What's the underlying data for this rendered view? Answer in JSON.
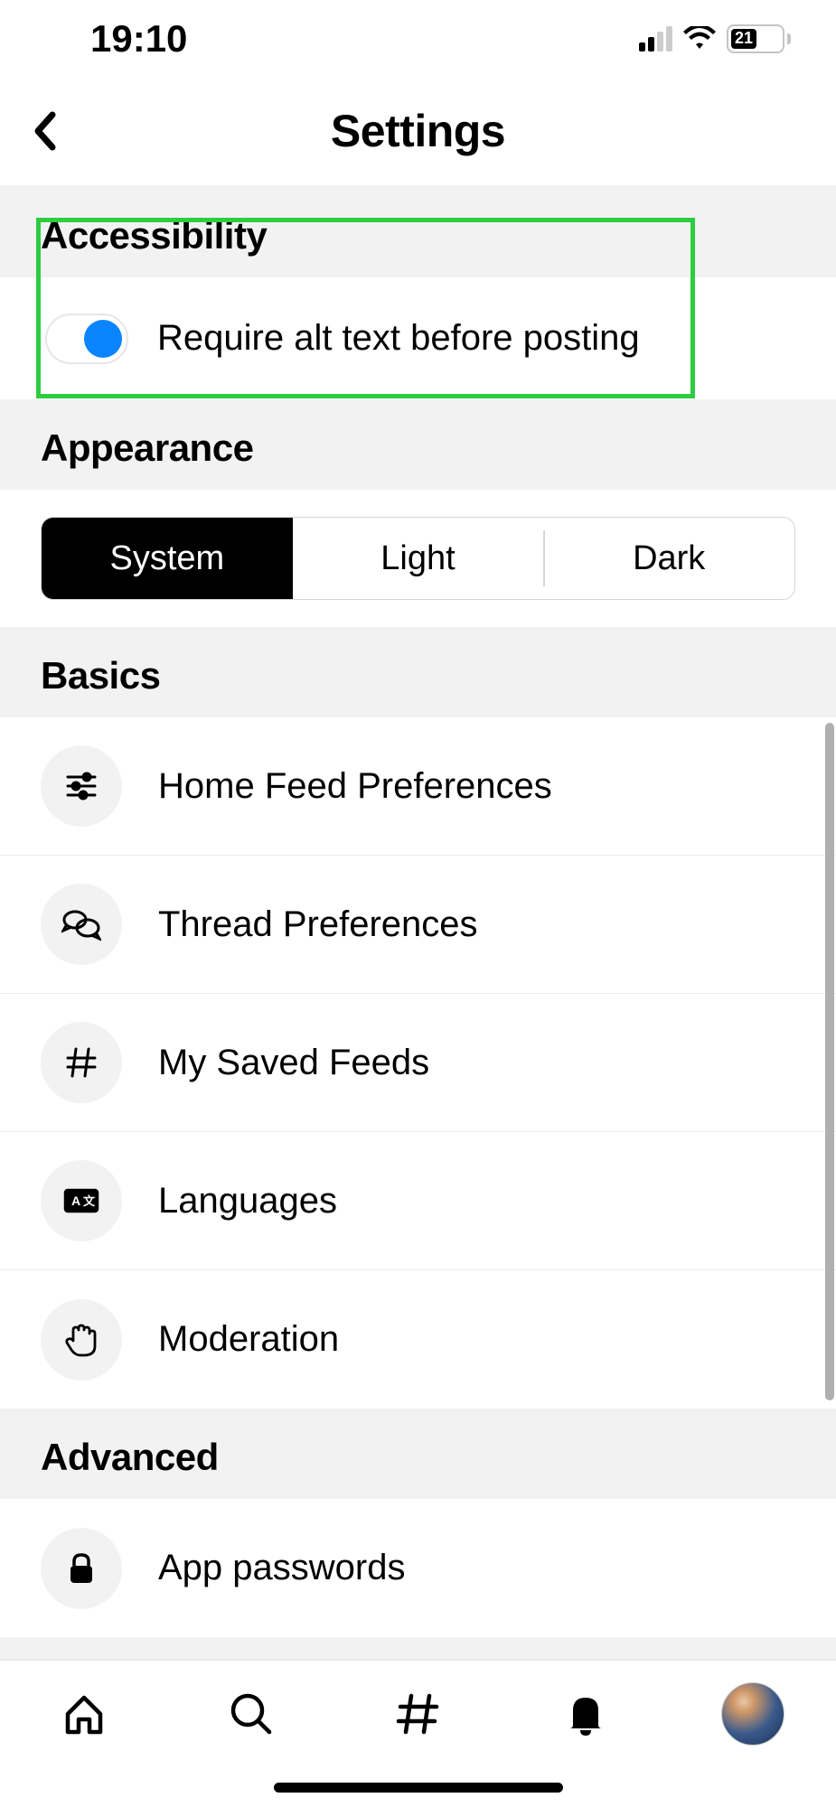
{
  "status": {
    "time": "19:10",
    "battery": "21"
  },
  "header": {
    "title": "Settings"
  },
  "sections": {
    "accessibility": {
      "title": "Accessibility",
      "toggle_label": "Require alt text before posting"
    },
    "appearance": {
      "title": "Appearance",
      "options": {
        "system": "System",
        "light": "Light",
        "dark": "Dark"
      }
    },
    "basics": {
      "title": "Basics",
      "items": {
        "home_feed": "Home Feed Preferences",
        "thread": "Thread Preferences",
        "saved_feeds": "My Saved Feeds",
        "languages": "Languages",
        "moderation": "Moderation"
      }
    },
    "advanced": {
      "title": "Advanced",
      "items": {
        "app_passwords": "App passwords"
      }
    }
  }
}
